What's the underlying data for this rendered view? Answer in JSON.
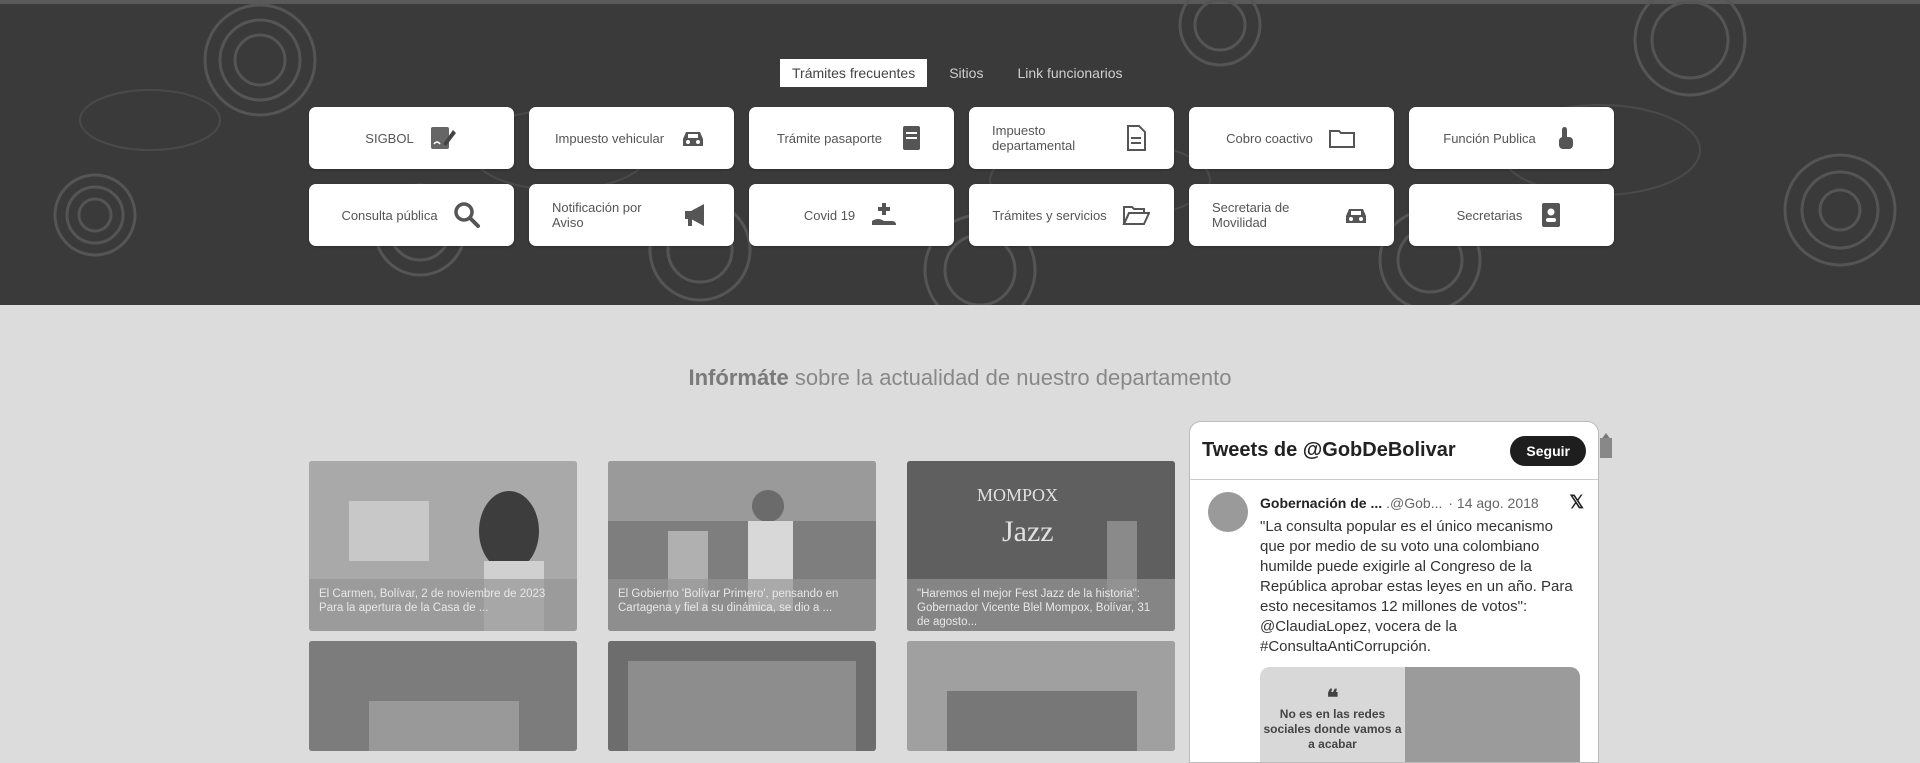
{
  "tabs": {
    "items": [
      "Trámites frecuentes",
      "Sitios",
      "Link funcionarios"
    ]
  },
  "services": [
    {
      "label": "SIGBOL",
      "icon": "signature-icon"
    },
    {
      "label": "Impuesto vehicular",
      "icon": "car-icon"
    },
    {
      "label": "Trámite pasaporte",
      "icon": "passport-book-icon"
    },
    {
      "label": "Impuesto departamental",
      "icon": "document-icon"
    },
    {
      "label": "Cobro coactivo",
      "icon": "folder-icon"
    },
    {
      "label": "Función Publica",
      "icon": "hand-pointer-icon"
    },
    {
      "label": "Consulta pública",
      "icon": "search-icon"
    },
    {
      "label": "Notificación por Aviso",
      "icon": "megaphone-icon"
    },
    {
      "label": "Covid 19",
      "icon": "hand-plus-icon"
    },
    {
      "label": "Trámites y servicios",
      "icon": "folder-open-icon"
    },
    {
      "label": "Secretaria de Movilidad",
      "icon": "car-icon"
    },
    {
      "label": "Secretarias",
      "icon": "id-badge-icon"
    }
  ],
  "headline": {
    "bold": "Infórmáte",
    "rest": " sobre la actualidad de nuestro departamento"
  },
  "news": [
    {
      "caption": "El Carmen, Bolívar, 2 de noviembre de 2023 Para la apertura de la Casa de ..."
    },
    {
      "caption": "El Gobierno 'Bolívar Primero', pensando en Cartagena y fiel a su dinámica, se dio a ..."
    },
    {
      "caption": "\"Haremos el mejor Fest Jazz de la historia\": Gobernador Vicente Blel Mompox, Bolívar, 31 de agosto..."
    },
    {
      "caption": ""
    },
    {
      "caption": ""
    },
    {
      "caption": ""
    }
  ],
  "tweets": {
    "title": "Tweets de @GobDeBolivar",
    "follow_label": "Seguir",
    "author": "Gobernación de ...",
    "handle": ".@Gob...",
    "date": "· 14 ago. 2018",
    "text": "\"La consulta popular es el único mecanismo que por medio de su voto una colombiano humilde puede exigirle al Congreso de la República aprobar estas leyes en un año. Para esto necesitamos 12 millones de votos\": @ClaudiaLopez, vocera de la #ConsultaAntiCorrupción.",
    "media_quote": "No es en las redes sociales donde vamos a a acabar"
  }
}
